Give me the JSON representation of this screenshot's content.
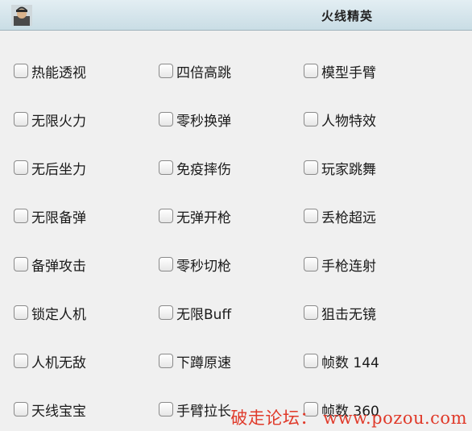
{
  "window": {
    "title": "火线精英",
    "icon": "avatar-icon"
  },
  "options": {
    "col1": [
      "热能透视",
      "无限火力",
      "无后坐力",
      "无限备弹",
      "备弹攻击",
      "锁定人机",
      "人机无敌",
      "天线宝宝"
    ],
    "col2": [
      "四倍高跳",
      "零秒换弹",
      "免疫摔伤",
      "无弹开枪",
      "零秒切枪",
      "无限Buff",
      "下蹲原速",
      "手臂拉长"
    ],
    "col3": [
      "模型手臂",
      "人物特效",
      "玩家跳舞",
      "丢枪超远",
      "手枪连射",
      "狙击无镜",
      "帧数 144",
      "帧数 360"
    ]
  },
  "watermark": "破走论坛： www.pozou.com",
  "colors": {
    "watermark": "#e03a2a",
    "titlebar": "#d6e6ec",
    "background": "#f0f0f0"
  }
}
